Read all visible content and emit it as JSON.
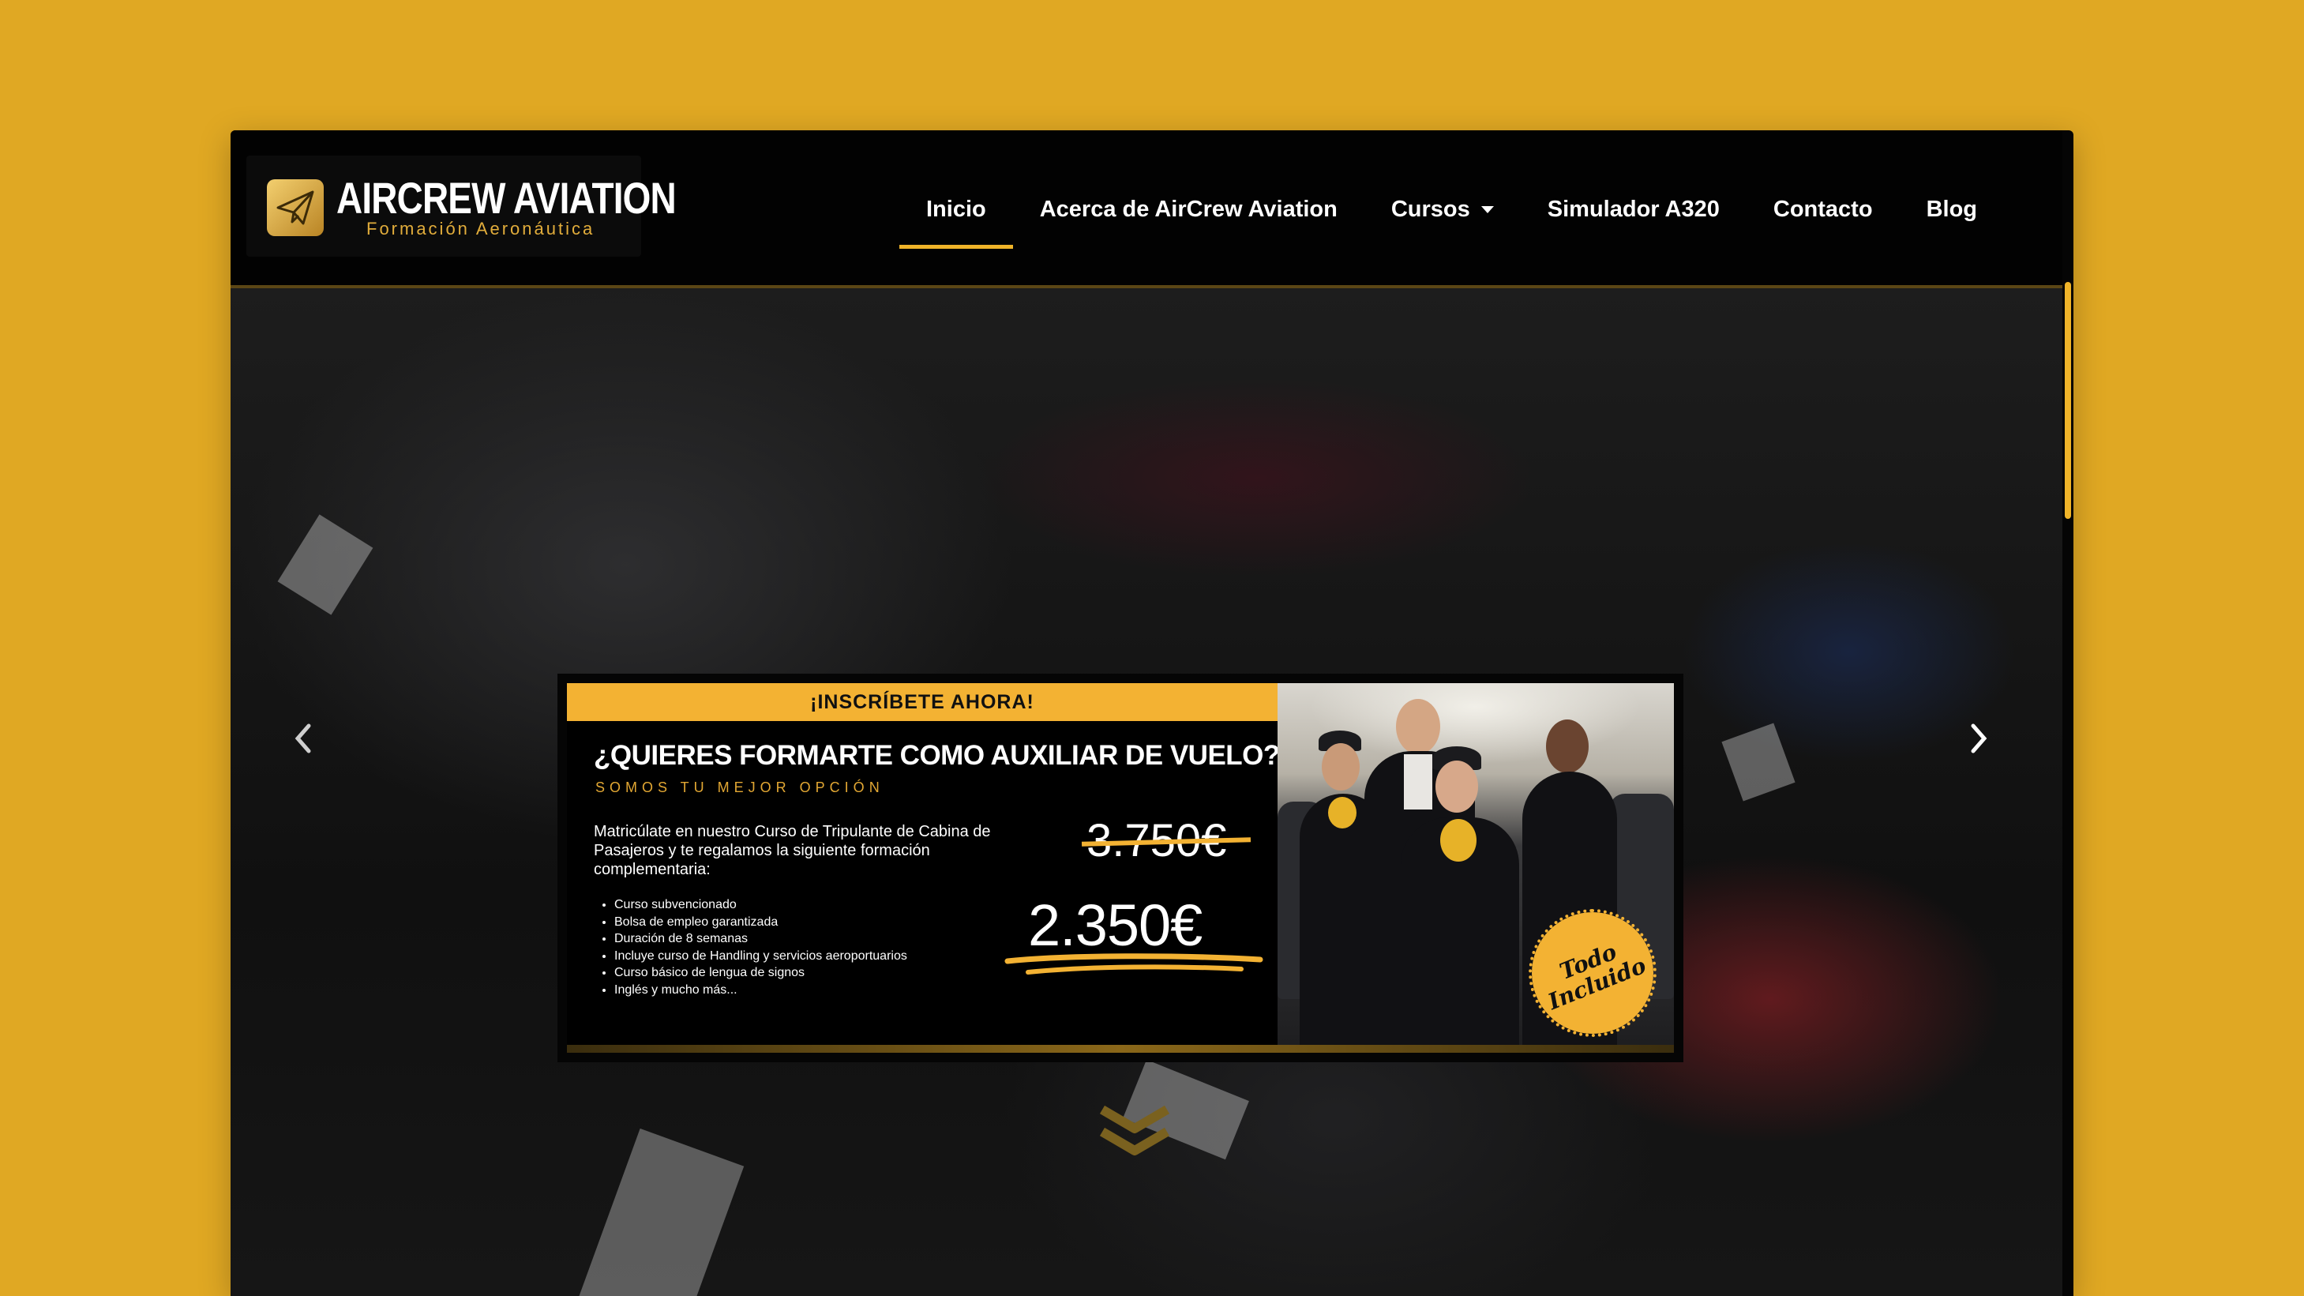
{
  "brand": {
    "name": "AIRCREW AVIATION",
    "subtitle": "Formación Aeronáutica",
    "icon": "paper-plane-icon"
  },
  "nav": {
    "items": [
      {
        "label": "Inicio",
        "active": true
      },
      {
        "label": "Acerca de AirCrew Aviation"
      },
      {
        "label": "Cursos",
        "dropdown": true
      },
      {
        "label": "Simulador A320"
      },
      {
        "label": "Contacto"
      },
      {
        "label": "Blog"
      }
    ]
  },
  "slider": {
    "prev_icon": "chevron-left-icon",
    "next_icon": "chevron-right-icon",
    "scroll_icon": "double-chevron-down-icon"
  },
  "banner": {
    "ribbon": "¡INSCRÍBETE AHORA!",
    "headline": "¿QUIERES FORMARTE COMO AUXILIAR DE VUELO?",
    "tagline": "SOMOS TU MEJOR OPCIÓN",
    "intro": "Matricúlate en nuestro Curso de Tripulante de Cabina de Pasajeros y te regalamos la siguiente formación complementaria:",
    "bullets": [
      "Curso subvencionado",
      "Bolsa de empleo garantizada",
      "Duración de 8 semanas",
      "Incluye curso de Handling y servicios aeroportuarios",
      "Curso básico de lengua de signos",
      "Inglés y mucho más..."
    ],
    "old_price": "3.750€",
    "new_price": "2.350€",
    "stamp_line1": "Todo",
    "stamp_line2": "Incluido"
  },
  "colors": {
    "accent": "#F3B233",
    "page_bg": "#E0A823",
    "nav_bg": "#020202"
  }
}
